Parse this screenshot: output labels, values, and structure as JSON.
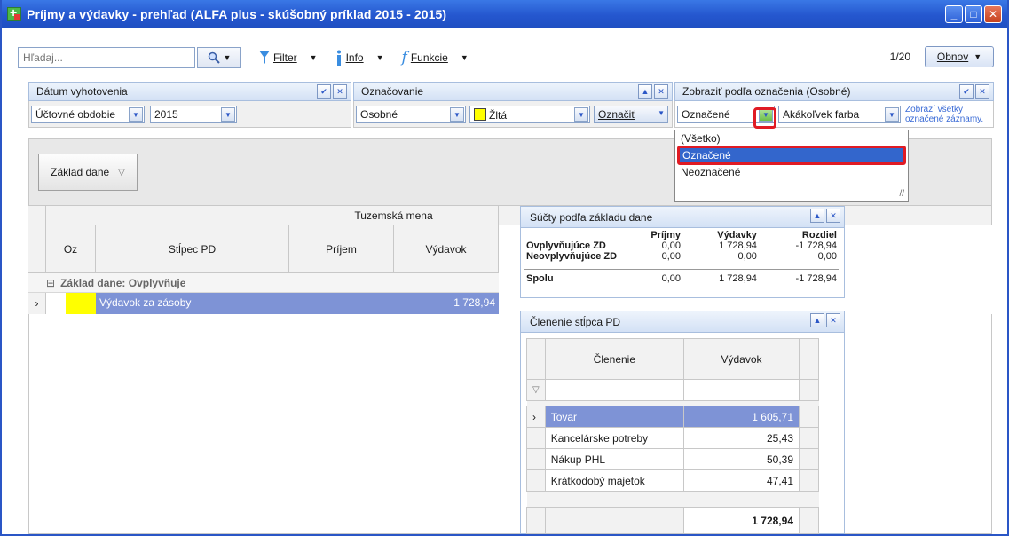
{
  "window": {
    "title": "Príjmy a výdavky - prehľad (ALFA plus - skúšobný príklad 2015 - 2015)",
    "accent": "#2557cf"
  },
  "toolbar": {
    "search_placeholder": "Hľadaj...",
    "filter_label": "Filter",
    "info_label": "Info",
    "functions_label": "Funkcie",
    "pager": "1/20",
    "refresh_label": "Obnov"
  },
  "panel_date": {
    "title": "Dátum vyhotovenia",
    "period_value": "Účtovné obdobie",
    "year_value": "2015"
  },
  "panel_marking": {
    "title": "Označovanie",
    "type_value": "Osobné",
    "color_value": "Žltá",
    "mark_button": "Označiť"
  },
  "panel_show": {
    "title": "Zobraziť podľa označenia (Osobné)",
    "selected_value": "Označené",
    "color_value": "Akákoľvek farba",
    "hint_line1": "Zobrazí všetky",
    "hint_line2": "označené záznamy."
  },
  "dropdown": {
    "options": [
      "(Všetko)",
      "Označené",
      "Neoznačené"
    ],
    "selected_index": 1
  },
  "grid": {
    "group_chip": "Základ dane",
    "band_header": "Tuzemská mena",
    "columns": [
      "Oz",
      "Stĺpec PD",
      "Príjem",
      "Výdavok"
    ],
    "group_label": "Základ dane: Ovplyvňuje",
    "rows": [
      {
        "marker_color": "#ffff00",
        "column": "Výdavok za zásoby",
        "income": "",
        "expense": "1 728,94"
      }
    ]
  },
  "sums_panel": {
    "title": "Súčty podľa základu dane",
    "headers": [
      "Príjmy",
      "Výdavky",
      "Rozdiel"
    ],
    "rows": [
      {
        "label": "Ovplyvňujúce ZD",
        "income": "0,00",
        "expense": "1 728,94",
        "diff": "-1 728,94"
      },
      {
        "label": "Neovplyvňujúce ZD",
        "income": "0,00",
        "expense": "0,00",
        "diff": "0,00"
      }
    ],
    "total": {
      "label": "Spolu",
      "income": "0,00",
      "expense": "1 728,94",
      "diff": "-1 728,94"
    }
  },
  "breakdown_panel": {
    "title": "Členenie stĺpca PD",
    "columns": [
      "Členenie",
      "Výdavok"
    ],
    "rows": [
      {
        "name": "Tovar",
        "amount": "1 605,71"
      },
      {
        "name": "Kancelárske potreby",
        "amount": "25,43"
      },
      {
        "name": "Nákup PHL",
        "amount": "50,39"
      },
      {
        "name": "Krátkodobý majetok",
        "amount": "47,41"
      }
    ],
    "total": "1 728,94"
  }
}
